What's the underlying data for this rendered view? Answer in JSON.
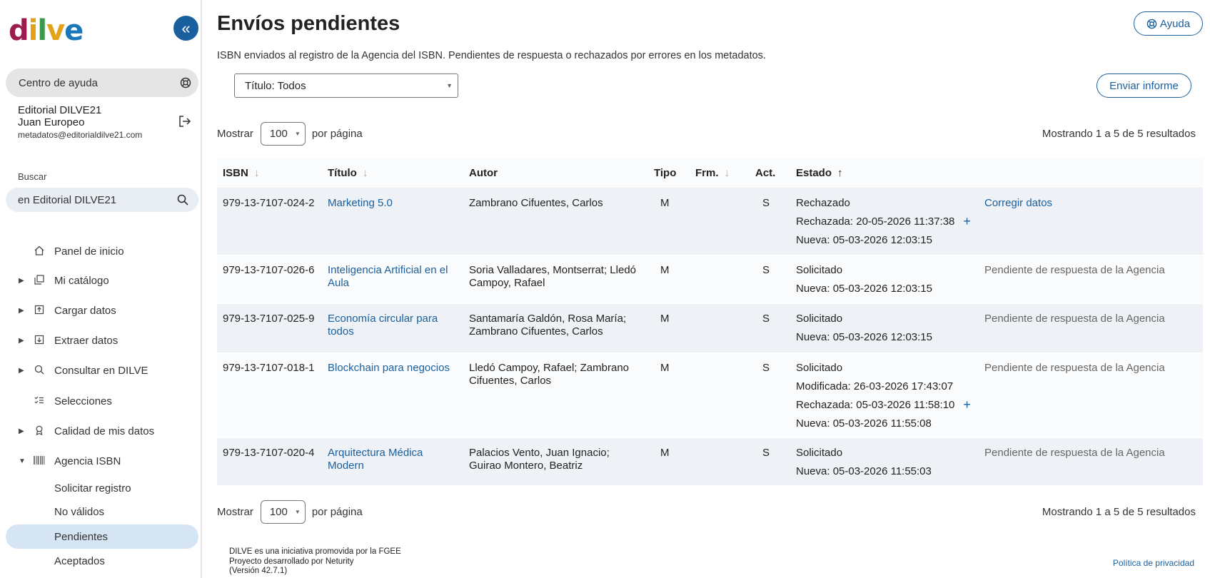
{
  "sidebar": {
    "logo": {
      "d": "d",
      "i": "i",
      "l": "l",
      "v": "v",
      "e": "e"
    },
    "collapse_icon": "«",
    "help_center": "Centro de ayuda",
    "user": {
      "editorial": "Editorial DILVE21",
      "name": "Juan Europeo",
      "email": "metadatos@editorialdilve21.com"
    },
    "search_label": "Buscar",
    "search_value": "en Editorial DILVE21",
    "nav": [
      {
        "label": "Panel de inicio",
        "icon": "home-icon"
      },
      {
        "label": "Mi catálogo",
        "icon": "catalog-icon"
      },
      {
        "label": "Cargar datos",
        "icon": "upload-icon"
      },
      {
        "label": "Extraer datos",
        "icon": "download-icon"
      },
      {
        "label": "Consultar en DILVE",
        "icon": "search-icon"
      },
      {
        "label": "Selecciones",
        "icon": "checklist-icon"
      },
      {
        "label": "Calidad de mis datos",
        "icon": "badge-icon"
      },
      {
        "label": "Agencia ISBN",
        "icon": "barcode-icon"
      },
      {
        "label": "Solicitar registro"
      },
      {
        "label": "No válidos"
      },
      {
        "label": "Pendientes"
      },
      {
        "label": "Aceptados"
      }
    ]
  },
  "main": {
    "title": "Envíos pendientes",
    "help_button": "Ayuda",
    "subtitle": "ISBN enviados al registro de la Agencia del ISBN. Pendientes de respuesta o rechazados por errores en los metadatos.",
    "title_filter": "Título: Todos",
    "send_report": "Enviar informe",
    "pager": {
      "show": "Mostrar",
      "per_page_value": "100",
      "per_page": "por página",
      "results": "Mostrando 1 a 5 de 5 resultados"
    },
    "columns": {
      "isbn": "ISBN",
      "titulo": "Título",
      "autor": "Autor",
      "tipo": "Tipo",
      "frm": "Frm.",
      "act": "Act.",
      "estado": "Estado"
    },
    "rows": [
      {
        "isbn": "979-13-7107-024-2",
        "titulo": "Marketing 5.0",
        "autor": "Zambrano Cifuentes, Carlos",
        "tipo": "M",
        "act": "S",
        "estado": [
          "Rechazado",
          "Rechazada: 20-05-2026 11:37:38",
          "Nueva: 05-03-2026 12:03:15"
        ],
        "accion": "Corregir datos"
      },
      {
        "isbn": "979-13-7107-026-6",
        "titulo": "Inteligencia Artificial en el Aula",
        "autor": "Soria Valladares, Montserrat; Lledó Campoy, Rafael",
        "tipo": "M",
        "act": "S",
        "estado": [
          "Solicitado",
          "Nueva: 05-03-2026 12:03:15"
        ],
        "accion": "Pendiente de respuesta de la Agencia"
      },
      {
        "isbn": "979-13-7107-025-9",
        "titulo": "Economía circular para todos",
        "autor": "Santamaría Galdón, Rosa María; Zambrano Cifuentes, Carlos",
        "tipo": "M",
        "act": "S",
        "estado": [
          "Solicitado",
          "Nueva: 05-03-2026 12:03:15"
        ],
        "accion": "Pendiente de respuesta de la Agencia"
      },
      {
        "isbn": "979-13-7107-018-1",
        "titulo": "Blockchain para negocios",
        "autor": "Lledó Campoy, Rafael; Zambrano Cifuentes, Carlos",
        "tipo": "M",
        "act": "S",
        "estado": [
          "Solicitado",
          "Modificada: 26-03-2026 17:43:07",
          "Rechazada: 05-03-2026 11:58:10",
          "Nueva: 05-03-2026 11:55:08"
        ],
        "accion": "Pendiente de respuesta de la Agencia"
      },
      {
        "isbn": "979-13-7107-020-4",
        "titulo": "Arquitectura Médica Modern",
        "autor": "Palacios Vento, Juan Ignacio; Guirao Montero, Beatriz",
        "tipo": "M",
        "act": "S",
        "estado": [
          "Solicitado",
          "Nueva: 05-03-2026 11:55:03"
        ],
        "accion": "Pendiente de respuesta de la Agencia"
      }
    ]
  },
  "footer": {
    "line1": "DILVE es una iniciativa promovida por la FGEE",
    "line2": "Proyecto desarrollado por Neturity",
    "line3": "(Versión 42.7.1)",
    "privacy": "Política de privacidad"
  },
  "colors": {
    "accent": "#1a5f9e",
    "active_nav": "#d5e5f3",
    "row_shade": "#eef1f5"
  }
}
